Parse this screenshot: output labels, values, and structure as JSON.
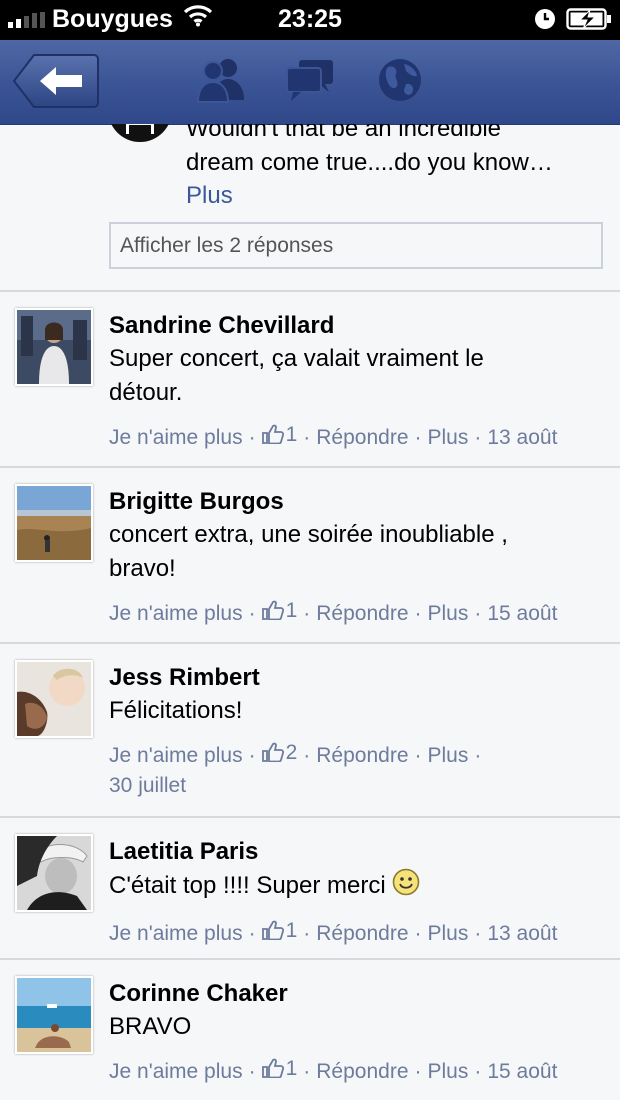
{
  "status_bar": {
    "carrier": "Bouygues",
    "time": "23:25",
    "icons": [
      "signal-icon",
      "wifi-icon",
      "clock-icon",
      "battery-charging-icon"
    ]
  },
  "nav": {
    "back_icon": "back-arrow-icon",
    "icons": [
      "friends-icon",
      "messages-icon",
      "globe-icon"
    ],
    "bar_color": "#3c5596"
  },
  "partial_comment": {
    "text_line1": "Wouldn't that be an incredible",
    "text_line2": "dream come true....do you know…",
    "more_link": "Plus",
    "replies_button": "Afficher les 2 réponses"
  },
  "action_labels": {
    "unlike": "Je n'aime plus",
    "reply": "Répondre",
    "more": "Plus",
    "separator": "·"
  },
  "comments": [
    {
      "author": "Sandrine Chevillard",
      "text": "Super concert, ça valait vraiment le détour.",
      "likes": "1",
      "date": "13 août"
    },
    {
      "author": "Brigitte Burgos",
      "text": "concert extra, une soirée inoubliable , bravo!",
      "likes": "1",
      "date": "15 août"
    },
    {
      "author": "Jess Rimbert",
      "text": "Félicitations!",
      "likes": "2",
      "date": "30 juillet"
    },
    {
      "author": "Laetitia Paris",
      "text": "C'était top !!!! Super merci",
      "likes": "1",
      "date": "13 août",
      "emoji": "smiley-icon"
    },
    {
      "author": "Corinne Chaker",
      "text": "BRAVO",
      "likes": "1",
      "date": "15 août"
    }
  ],
  "colors": {
    "link": "#3b5998",
    "meta": "#6d7c9c",
    "background": "#f6f7f9",
    "divider": "#d7d9de"
  }
}
